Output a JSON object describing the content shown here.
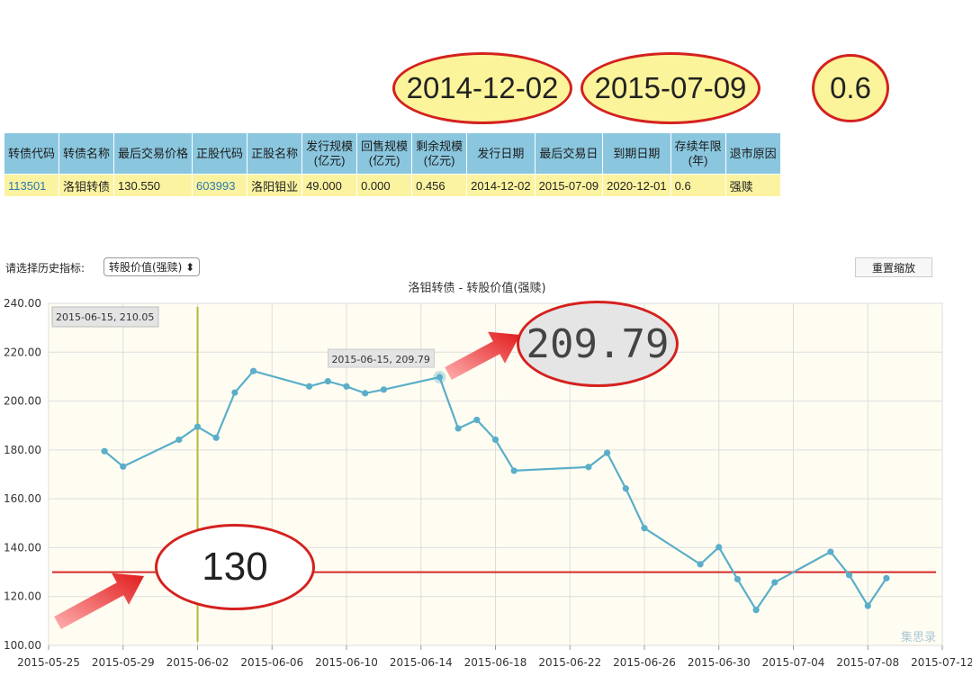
{
  "callouts": {
    "issue_date": "2014-12-02",
    "last_trade_date": "2015-07-09",
    "remaining_years": "0.6",
    "value": "209.79",
    "line": "130"
  },
  "table": {
    "headers": [
      "转债代码",
      "转债名称",
      "最后交易价格",
      "正股代码",
      "正股名称",
      "发行规模\n(亿元)",
      "回售规模\n(亿元)",
      "剩余规模\n(亿元)",
      "发行日期",
      "最后交易日",
      "到期日期",
      "存续年限\n(年)",
      "退市原因"
    ],
    "row": [
      "113501",
      "洛钼转债",
      "130.550",
      "603993",
      "洛阳钼业",
      "49.000",
      "0.000",
      "0.456",
      "2014-12-02",
      "2015-07-09",
      "2020-12-01",
      "0.6",
      "强赎"
    ]
  },
  "controls": {
    "selector_label": "请选择历史指标:",
    "selector_value": "转股价值(强赎) ⬍",
    "reset_label": "重置缩放"
  },
  "watermark": "集思录",
  "chart_data": {
    "type": "line",
    "title": "洛钼转债 - 转股价值(强赎)",
    "xlabel": "",
    "ylabel": "",
    "xlim": [
      "2015-05-25",
      "2015-07-12"
    ],
    "ylim": [
      100,
      240
    ],
    "x_ticks": [
      "2015-05-25",
      "2015-05-29",
      "2015-06-02",
      "2015-06-06",
      "2015-06-10",
      "2015-06-14",
      "2015-06-18",
      "2015-06-22",
      "2015-06-26",
      "2015-06-30",
      "2015-07-04",
      "2015-07-08",
      "2015-07-12"
    ],
    "y_ticks": [
      "100.00",
      "120.00",
      "140.00",
      "160.00",
      "180.00",
      "200.00",
      "220.00",
      "240.00"
    ],
    "grid": true,
    "series": [
      {
        "x": [
          "2015-05-28",
          "2015-05-29",
          "2015-06-01",
          "2015-06-02",
          "2015-06-03",
          "2015-06-04",
          "2015-06-05",
          "2015-06-08",
          "2015-06-09",
          "2015-06-10",
          "2015-06-11",
          "2015-06-12",
          "2015-06-15",
          "2015-06-16",
          "2015-06-17",
          "2015-06-18",
          "2015-06-19",
          "2015-06-23",
          "2015-06-24",
          "2015-06-25",
          "2015-06-26",
          "2015-06-29",
          "2015-06-30",
          "2015-07-01",
          "2015-07-02",
          "2015-07-03",
          "2015-07-06",
          "2015-07-07",
          "2015-07-08",
          "2015-07-09"
        ],
        "values": [
          179.5,
          173.2,
          184.2,
          189.5,
          185.0,
          203.5,
          212.3,
          206.0,
          208.1,
          206.0,
          203.2,
          204.7,
          209.79,
          188.8,
          192.3,
          184.2,
          171.5,
          173.0,
          178.8,
          164.2,
          148.0,
          133.2,
          140.2,
          127.1,
          114.5,
          125.8,
          138.3,
          128.8,
          116.2,
          127.5
        ]
      }
    ],
    "reference_line": {
      "value": 130,
      "color": "#d42a2a"
    },
    "crosshair": {
      "x": "2015-06-02",
      "color": "#b8b832"
    },
    "tooltips": [
      {
        "text": "2015-06-15, 210.05",
        "placement": "top-left"
      },
      {
        "text": "2015-06-15, 209.79",
        "x": "2015-06-15",
        "y": 209.79
      }
    ],
    "colors": {
      "line": "#5aaec9",
      "background": "#fffdf2",
      "grid": "#dddddd"
    }
  }
}
